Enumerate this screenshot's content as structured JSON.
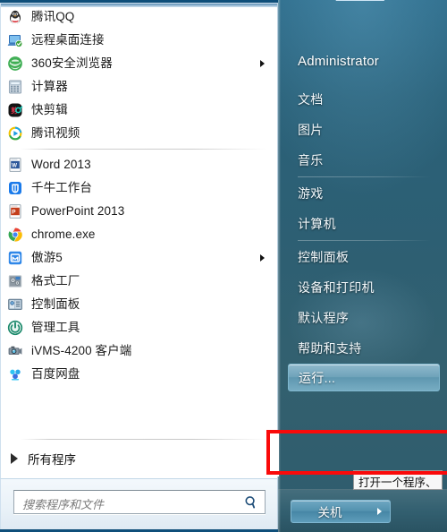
{
  "window": {
    "name": "windows-start-menu"
  },
  "left_panel": {
    "programs": [
      {
        "label": "腾讯QQ",
        "icon": "qq-penguin-icon",
        "has_submenu": false,
        "separator_after": false
      },
      {
        "label": "远程桌面连接",
        "icon": "remote-desktop-icon",
        "has_submenu": false,
        "separator_after": false
      },
      {
        "label": "360安全浏览器",
        "icon": "360-browser-icon",
        "has_submenu": true,
        "separator_after": false
      },
      {
        "label": "计算器",
        "icon": "calculator-icon",
        "has_submenu": false,
        "separator_after": false
      },
      {
        "label": "快剪辑",
        "icon": "kuaijianji-icon",
        "has_submenu": false,
        "separator_after": false
      },
      {
        "label": "腾讯视频",
        "icon": "tencent-video-icon",
        "has_submenu": false,
        "separator_after": true
      },
      {
        "label": "Word 2013",
        "icon": "word-icon",
        "has_submenu": false,
        "separator_after": false
      },
      {
        "label": "千牛工作台",
        "icon": "qianniu-icon",
        "has_submenu": false,
        "separator_after": false
      },
      {
        "label": "PowerPoint 2013",
        "icon": "powerpoint-icon",
        "has_submenu": false,
        "separator_after": false
      },
      {
        "label": "chrome.exe",
        "icon": "chrome-icon",
        "has_submenu": false,
        "separator_after": false
      },
      {
        "label": "傲游5",
        "icon": "maxthon-icon",
        "has_submenu": true,
        "separator_after": false
      },
      {
        "label": "格式工厂",
        "icon": "format-factory-icon",
        "has_submenu": false,
        "separator_after": false
      },
      {
        "label": "控制面板",
        "icon": "control-panel-icon",
        "has_submenu": false,
        "separator_after": false
      },
      {
        "label": "管理工具",
        "icon": "admin-tools-icon",
        "has_submenu": false,
        "separator_after": false
      },
      {
        "label": "iVMS-4200 客户端",
        "icon": "ivms-camera-icon",
        "has_submenu": false,
        "separator_after": false
      },
      {
        "label": "百度网盘",
        "icon": "baidu-netdisk-icon",
        "has_submenu": false,
        "separator_after": false
      }
    ],
    "all_programs": {
      "label": "所有程序",
      "icon": "right-triangle-icon"
    },
    "search": {
      "placeholder": "搜索程序和文件",
      "value": "",
      "icon": "search-icon"
    }
  },
  "right_panel": {
    "user_name": "Administrator",
    "avatar_icon": "user-picture-frame-icon",
    "places": [
      {
        "label": "文档",
        "separator_after": false,
        "hovered": false
      },
      {
        "label": "图片",
        "separator_after": false,
        "hovered": false
      },
      {
        "label": "音乐",
        "separator_after": true,
        "hovered": false
      },
      {
        "label": "游戏",
        "separator_after": false,
        "hovered": false
      },
      {
        "label": "计算机",
        "separator_after": true,
        "hovered": false
      },
      {
        "label": "控制面板",
        "separator_after": false,
        "hovered": false
      },
      {
        "label": "设备和打印机",
        "separator_after": false,
        "hovered": false
      },
      {
        "label": "默认程序",
        "separator_after": false,
        "hovered": false
      },
      {
        "label": "帮助和支持",
        "separator_after": false,
        "hovered": false
      },
      {
        "label": "运行...",
        "separator_after": false,
        "hovered": true
      }
    ],
    "shutdown": {
      "label": "关机",
      "arrow_icon": "chevron-right-icon"
    }
  },
  "tooltip": {
    "text": "打开一个程序、"
  },
  "annotation": {
    "color": "#fa0a0a",
    "target": "运行..."
  },
  "colors": {
    "right_panel_bg": "#2d5f73",
    "left_panel_bg": "#ffffff",
    "accent_highlight": "#6fa3ba",
    "annotation_red": "#fa0a0a",
    "desktop_blue": "#0f4f7a"
  }
}
